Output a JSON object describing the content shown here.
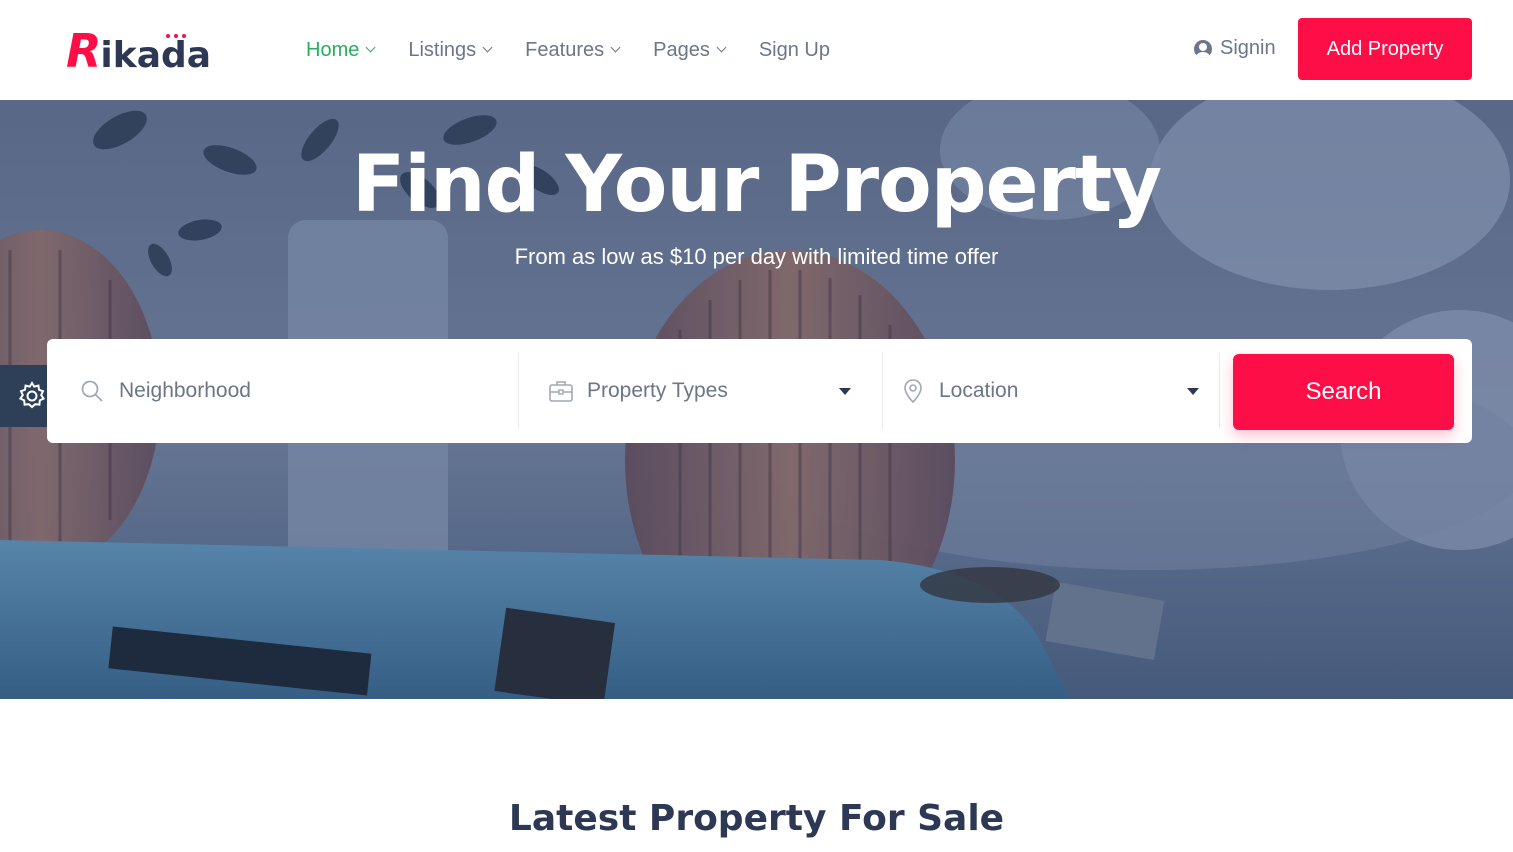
{
  "brand": {
    "logo_initial": "R",
    "logo_rest": "ikada",
    "primary_color": "#fd0e46",
    "active_nav_color": "#27ae60"
  },
  "nav": {
    "items": [
      {
        "label": "Home",
        "has_dropdown": true,
        "active": true
      },
      {
        "label": "Listings",
        "has_dropdown": true
      },
      {
        "label": "Features",
        "has_dropdown": true
      },
      {
        "label": "Pages",
        "has_dropdown": true
      },
      {
        "label": "Sign Up",
        "has_dropdown": false
      }
    ],
    "signin_label": "Signin",
    "add_property_label": "Add Property"
  },
  "hero": {
    "title": "Find Your Property",
    "subtitle": "From as low as $10 per day with limited time offer"
  },
  "search": {
    "neighborhood_placeholder": "Neighborhood",
    "property_types_placeholder": "Property Types",
    "location_placeholder": "Location",
    "button_label": "Search"
  },
  "section": {
    "title": "Latest Property For Sale"
  }
}
